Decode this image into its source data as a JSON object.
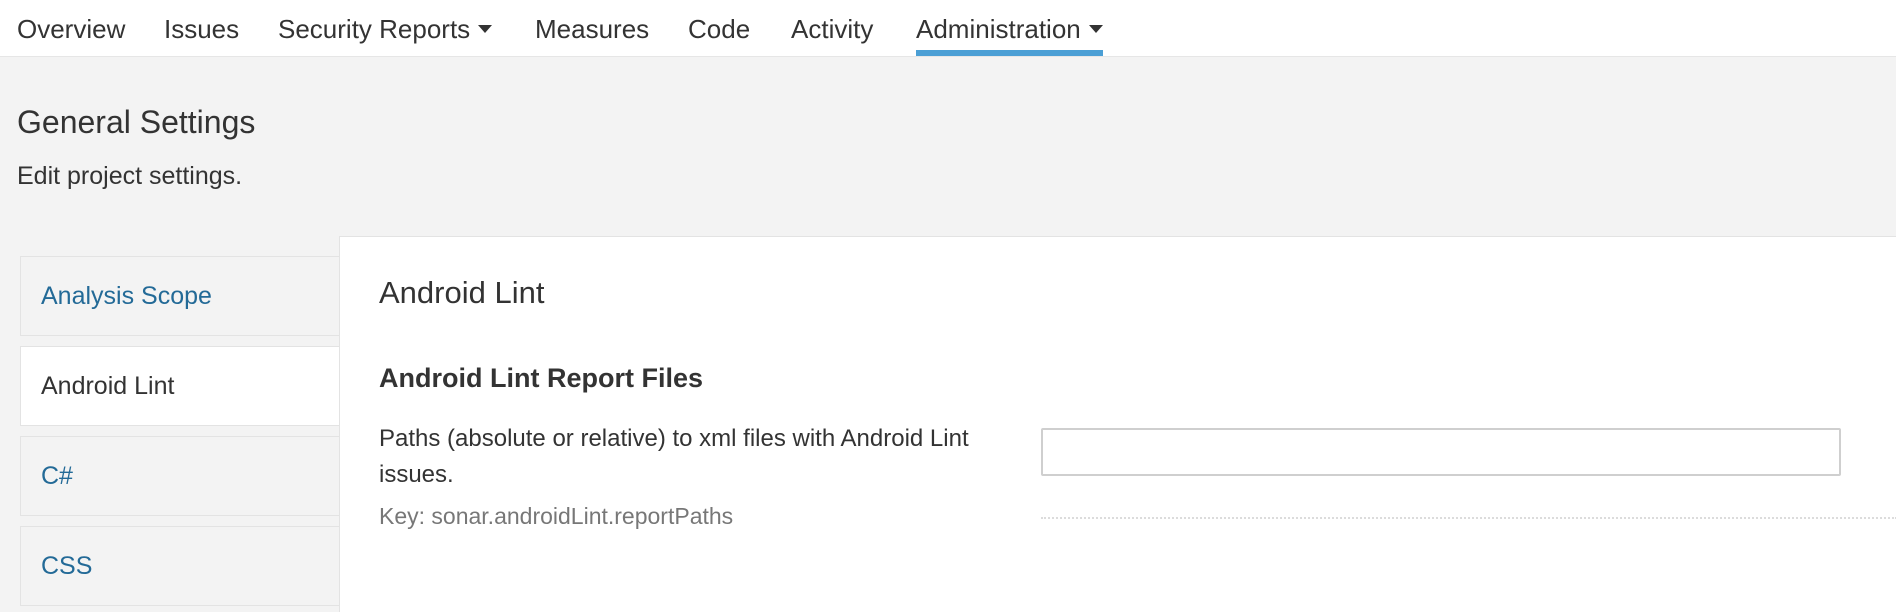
{
  "nav": {
    "items": [
      {
        "label": "Overview"
      },
      {
        "label": "Issues"
      },
      {
        "label": "Security Reports",
        "has_dropdown": true
      },
      {
        "label": "Measures"
      },
      {
        "label": "Code"
      },
      {
        "label": "Activity"
      },
      {
        "label": "Administration",
        "has_dropdown": true,
        "active": true
      }
    ],
    "active_color": "#4b9fd5"
  },
  "page": {
    "title": "General Settings",
    "description": "Edit project settings."
  },
  "categories": {
    "items": [
      {
        "label": "Analysis Scope"
      },
      {
        "label": "Android Lint",
        "active": true
      },
      {
        "label": "C#"
      },
      {
        "label": "CSS"
      }
    ],
    "link_color": "#236a97"
  },
  "panel": {
    "section_title": "Android Lint",
    "setting": {
      "title": "Android Lint Report Files",
      "description": "Paths (absolute or relative) to xml files with Android Lint issues.",
      "key": "Key: sonar.androidLint.reportPaths",
      "value": ""
    }
  },
  "icons": {
    "dropdown": "caret-down-icon"
  }
}
